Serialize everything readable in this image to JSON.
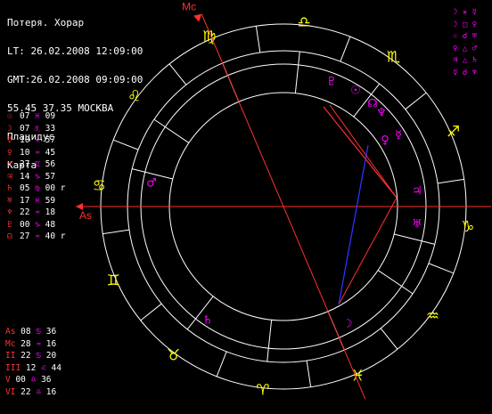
{
  "header": {
    "title": "Потеря. Хорар",
    "lt": "LT: 26.02.2008 12:09:00",
    "gmt": "GMT:26.02.2008 09:09:00",
    "location": "55.45 37.35 МОСКВА",
    "house_system": "Плацидус",
    "chart_label": "Карта"
  },
  "planet_positions": [
    {
      "glyph": "☉",
      "deg": "07",
      "sign": "♓",
      "min": "09",
      "retro": "",
      "color": "#ff3030"
    },
    {
      "glyph": "☽",
      "deg": "07",
      "sign": "♏",
      "min": "33",
      "retro": "",
      "color": "#ff3030"
    },
    {
      "glyph": "☿",
      "deg": "10",
      "sign": "♒",
      "min": "57",
      "retro": "",
      "color": "#ff3030"
    },
    {
      "glyph": "♀",
      "deg": "10",
      "sign": "♒",
      "min": "45",
      "retro": "",
      "color": "#ff3030"
    },
    {
      "glyph": "♂",
      "deg": "27",
      "sign": "♊",
      "min": "56",
      "retro": "",
      "color": "#ff3030"
    },
    {
      "glyph": "♃",
      "deg": "14",
      "sign": "♑",
      "min": "57",
      "retro": "",
      "color": "#ff3030"
    },
    {
      "glyph": "♄",
      "deg": "05",
      "sign": "♍",
      "min": "00",
      "retro": "r",
      "color": "#ff3030"
    },
    {
      "glyph": "♅",
      "deg": "17",
      "sign": "♓",
      "min": "59",
      "retro": "",
      "color": "#ff3030"
    },
    {
      "glyph": "♆",
      "deg": "22",
      "sign": "♒",
      "min": "18",
      "retro": "",
      "color": "#ff3030"
    },
    {
      "glyph": "♇",
      "deg": "00",
      "sign": "♑",
      "min": "48",
      "retro": "",
      "color": "#ff3030"
    },
    {
      "glyph": "☊",
      "deg": "27",
      "sign": "♒",
      "min": "40",
      "retro": "r",
      "color": "#ff3030"
    }
  ],
  "cusps": [
    {
      "label": "As",
      "deg": "08",
      "sign": "♋",
      "min": "36"
    },
    {
      "label": "Mc",
      "deg": "28",
      "sign": "♒",
      "min": "16"
    },
    {
      "label": "II",
      "deg": "22",
      "sign": "♋",
      "min": "20"
    },
    {
      "label": "III",
      "deg": "12",
      "sign": "♌",
      "min": "44"
    },
    {
      "label": "V",
      "deg": "00",
      "sign": "♎",
      "min": "36"
    },
    {
      "label": "VI",
      "deg": "22",
      "sign": "♎",
      "min": "16"
    }
  ],
  "aspect_list": [
    "☽ ⚹ ☿",
    "☽ □ ♀",
    "☉ ☌ ♅",
    "♀ △ ♂",
    "♃ △ ♄",
    "☿ ☌ ♆"
  ],
  "wheel": {
    "asc_label": "As",
    "mc_label": "Mc",
    "signs": [
      {
        "glyph": "♈",
        "name": "aries"
      },
      {
        "glyph": "♉",
        "name": "taurus"
      },
      {
        "glyph": "♊",
        "name": "gemini"
      },
      {
        "glyph": "♋",
        "name": "cancer"
      },
      {
        "glyph": "♌",
        "name": "leo"
      },
      {
        "glyph": "♍",
        "name": "virgo"
      },
      {
        "glyph": "♎",
        "name": "libra"
      },
      {
        "glyph": "♏",
        "name": "scorpio"
      },
      {
        "glyph": "♐",
        "name": "sagittarius"
      },
      {
        "glyph": "♑",
        "name": "capricorn"
      },
      {
        "glyph": "♒",
        "name": "aquarius"
      },
      {
        "glyph": "♓",
        "name": "pisces"
      }
    ],
    "planets": [
      {
        "glyph": "♇",
        "name": "pluto"
      },
      {
        "glyph": "☉",
        "name": "sun"
      },
      {
        "glyph": "☊",
        "name": "node"
      },
      {
        "glyph": "♆",
        "name": "neptune"
      },
      {
        "glyph": "♀",
        "name": "venus"
      },
      {
        "glyph": "☿",
        "name": "mercury"
      },
      {
        "glyph": "♃",
        "name": "jupiter"
      },
      {
        "glyph": "♅",
        "name": "uranus"
      },
      {
        "glyph": "♂",
        "name": "mars"
      },
      {
        "glyph": "♄",
        "name": "saturn"
      },
      {
        "glyph": "☽",
        "name": "moon"
      }
    ],
    "colors": {
      "sign_glyph": "#ffff00",
      "planet_glyph": "#ff00ff",
      "axis": "#ff3030",
      "ring": "#ffffff",
      "aspect_red": "#ff3030",
      "aspect_blue": "#3030ff"
    }
  }
}
